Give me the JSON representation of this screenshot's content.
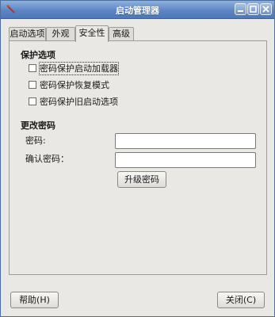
{
  "window": {
    "title": "启动管理器"
  },
  "tabs": [
    {
      "label": "启动选项"
    },
    {
      "label": "外观"
    },
    {
      "label": "安全性"
    },
    {
      "label": "高级"
    }
  ],
  "protection": {
    "heading": "保护选项",
    "options": [
      {
        "label": "密码保护启动加载器",
        "checked": false
      },
      {
        "label": "密码保护恢复模式",
        "checked": false
      },
      {
        "label": "密码保护旧启动选项",
        "checked": false
      }
    ]
  },
  "change_password": {
    "heading": "更改密码",
    "password_label": "密码:",
    "password_value": "",
    "confirm_label": "确认密码：",
    "confirm_value": "",
    "upgrade_button": "升级密码"
  },
  "footer": {
    "help_button": "帮助(H)",
    "close_button": "关闭(C)"
  }
}
